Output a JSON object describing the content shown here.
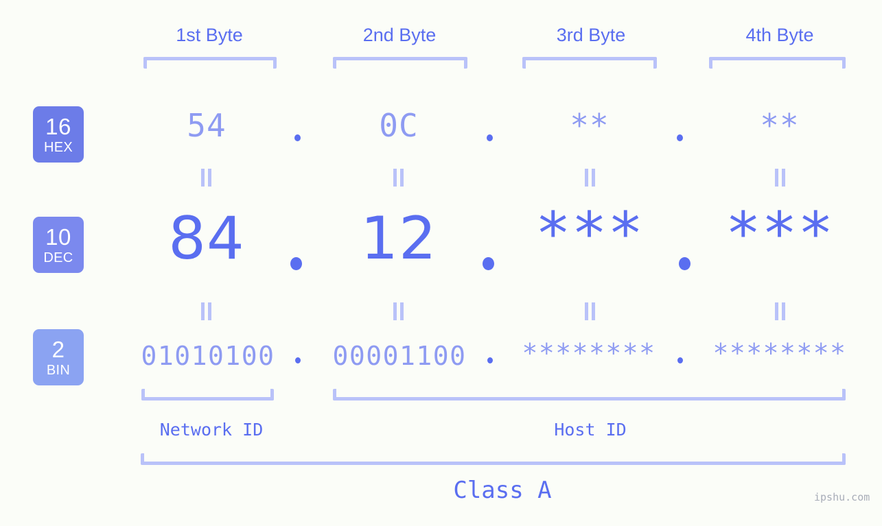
{
  "background": "#fbfdf8",
  "accent": "#5a6ef0",
  "accent_light": "#8e9bf2",
  "bracket_color": "#b9c2f9",
  "byte_headers": [
    {
      "label": "1st Byte"
    },
    {
      "label": "2nd Byte"
    },
    {
      "label": "3rd Byte"
    },
    {
      "label": "4th Byte"
    }
  ],
  "bases": [
    {
      "number": "16",
      "name": "HEX",
      "color": "#6c7ce8"
    },
    {
      "number": "10",
      "name": "DEC",
      "color": "#7b89ee"
    },
    {
      "number": "2",
      "name": "BIN",
      "color": "#8ba3f2"
    }
  ],
  "rows": {
    "hex": {
      "values": [
        "54",
        "0C",
        "**",
        "**"
      ]
    },
    "dec": {
      "values": [
        "84",
        "12",
        "***",
        "***"
      ]
    },
    "bin": {
      "values": [
        "01010100",
        "00001100",
        "********",
        "********"
      ]
    }
  },
  "separator": ".",
  "equals_symbol": "=",
  "sections": [
    {
      "label": "Network ID"
    },
    {
      "label": "Host ID"
    }
  ],
  "class": {
    "label": "Class A"
  },
  "watermark": {
    "text": "ipshu.com"
  }
}
